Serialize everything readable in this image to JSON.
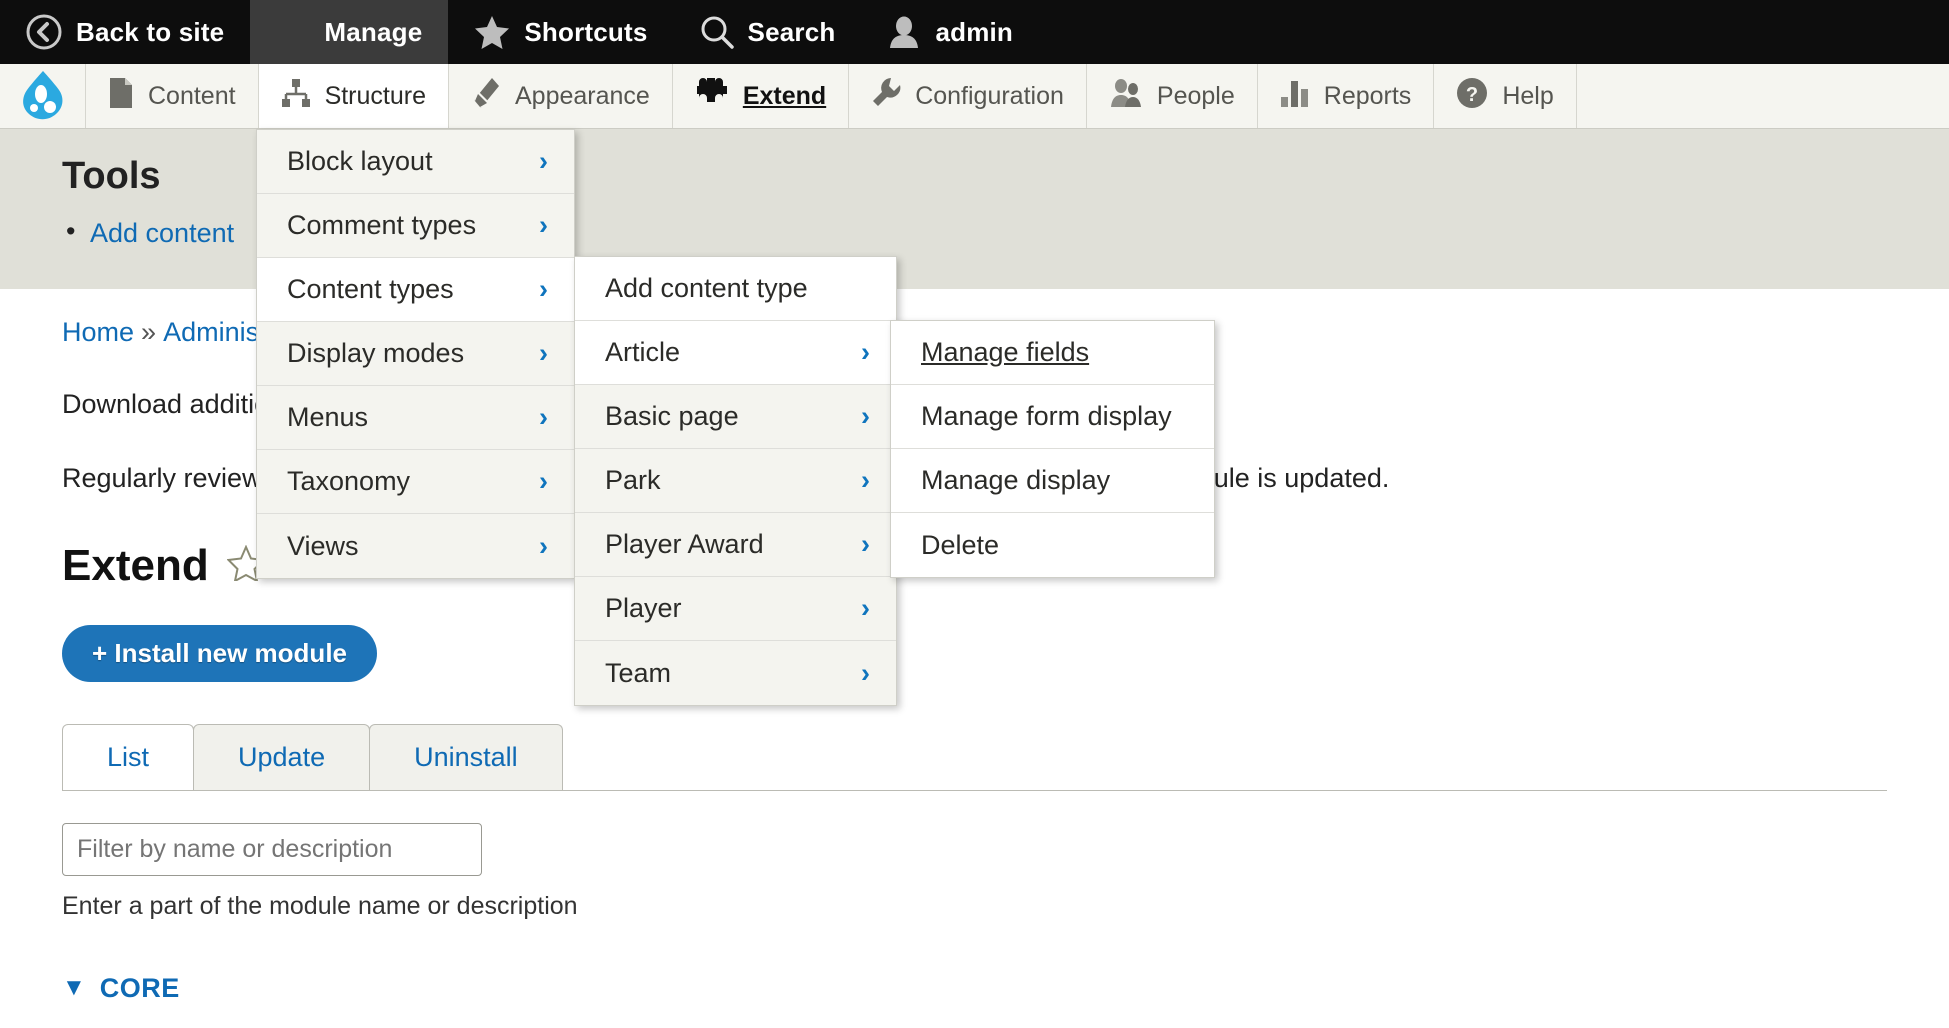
{
  "toolbar": {
    "items": [
      {
        "label": "Back to site",
        "icon": "back-arrow-icon",
        "active": false
      },
      {
        "label": "Manage",
        "icon": "hamburger-icon",
        "active": true
      },
      {
        "label": "Shortcuts",
        "icon": "star-icon",
        "active": false
      },
      {
        "label": "Search",
        "icon": "search-icon",
        "active": false
      },
      {
        "label": "admin",
        "icon": "user-icon",
        "active": false
      }
    ]
  },
  "tray": {
    "logo": "drupal-logo-icon",
    "items": [
      {
        "label": "Content",
        "icon": "document-icon",
        "state": "normal"
      },
      {
        "label": "Structure",
        "icon": "sitemap-icon",
        "state": "hovered"
      },
      {
        "label": "Appearance",
        "icon": "paintbrush-icon",
        "state": "normal"
      },
      {
        "label": "Extend",
        "icon": "puzzle-icon",
        "state": "current"
      },
      {
        "label": "Configuration",
        "icon": "wrench-icon",
        "state": "normal"
      },
      {
        "label": "People",
        "icon": "people-icon",
        "state": "normal"
      },
      {
        "label": "Reports",
        "icon": "bar-chart-icon",
        "state": "normal"
      },
      {
        "label": "Help",
        "icon": "question-mark-icon",
        "state": "normal"
      }
    ]
  },
  "tools": {
    "title": "Tools",
    "links": [
      {
        "label": "Add content"
      }
    ]
  },
  "breadcrumb": {
    "home": "Home",
    "separator": "»",
    "administration": "Administrat"
  },
  "main": {
    "intro_1": "Download additiona",
    "intro_2": "Regularly review and",
    "intro_2_tail": "ach time a module is updated.",
    "page_title": "Extend",
    "star_icon": "star-outline-icon",
    "install_button": "+ Install new module",
    "tabs": [
      {
        "label": "List",
        "active": true
      },
      {
        "label": "Update",
        "active": false
      },
      {
        "label": "Uninstall",
        "active": false
      }
    ],
    "filter": {
      "value": "",
      "placeholder": "Filter by name or description",
      "description": "Enter a part of the module name or description"
    },
    "core_section": {
      "caret": "▼",
      "label": "CORE"
    }
  },
  "menus": {
    "structure": {
      "items": [
        {
          "label": "Block layout",
          "chevron": "›",
          "highlighted": false
        },
        {
          "label": "Comment types",
          "chevron": "›",
          "highlighted": false
        },
        {
          "label": "Content types",
          "chevron": "›",
          "highlighted": true
        },
        {
          "label": "Display modes",
          "chevron": "›",
          "highlighted": false
        },
        {
          "label": "Menus",
          "chevron": "›",
          "highlighted": false
        },
        {
          "label": "Taxonomy",
          "chevron": "›",
          "highlighted": false
        },
        {
          "label": "Views",
          "chevron": "›",
          "highlighted": false
        }
      ]
    },
    "content_types": {
      "items": [
        {
          "label": "Add content type",
          "chevron": "",
          "highlighted": true
        },
        {
          "label": "Article",
          "chevron": "›",
          "highlighted": true
        },
        {
          "label": "Basic page",
          "chevron": "›",
          "highlighted": false
        },
        {
          "label": "Park",
          "chevron": "›",
          "highlighted": false
        },
        {
          "label": "Player Award",
          "chevron": "›",
          "highlighted": false
        },
        {
          "label": "Player",
          "chevron": "›",
          "highlighted": false
        },
        {
          "label": "Team",
          "chevron": "›",
          "highlighted": false
        }
      ]
    },
    "article": {
      "items": [
        {
          "label": "Manage fields",
          "chevron": "",
          "underlined": true
        },
        {
          "label": "Manage form display",
          "chevron": "",
          "underlined": false
        },
        {
          "label": "Manage display",
          "chevron": "",
          "underlined": false
        },
        {
          "label": "Delete",
          "chevron": "",
          "underlined": false
        }
      ]
    }
  },
  "colors": {
    "toolbar_bg": "#0d0d0d",
    "tray_bg": "#f5f5f0",
    "link_blue": "#0f6ab4",
    "button_blue": "#1e74b8",
    "chevron_blue": "#0f74bd",
    "tools_bg": "#e0e0d8"
  }
}
